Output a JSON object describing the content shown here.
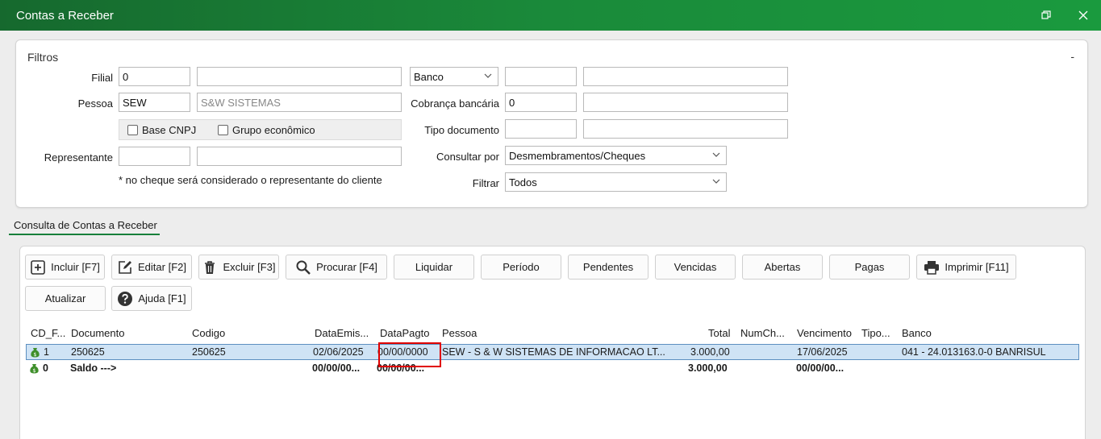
{
  "window": {
    "title": "Contas a Receber"
  },
  "filters": {
    "legend": "Filtros",
    "collapse": "-",
    "filial_label": "Filial",
    "filial_value": "0",
    "filial_desc": "",
    "pessoa_label": "Pessoa",
    "pessoa_value": "SEW",
    "pessoa_desc": "S&W SISTEMAS",
    "base_cnpj": "Base CNPJ",
    "grupo_economico": "Grupo econômico",
    "representante_label": "Representante",
    "representante_value": "",
    "representante_desc": "",
    "note": "* no cheque será considerado o representante do cliente",
    "banco_select": "Banco",
    "banco_code": "",
    "banco_desc": "",
    "cobranca_label": "Cobrança bancária",
    "cobranca_value": "0",
    "cobranca_desc": "",
    "tipo_doc_label": "Tipo documento",
    "tipo_doc_value": "",
    "tipo_doc_desc": "",
    "consultar_label": "Consultar por",
    "consultar_value": "Desmembramentos/Cheques",
    "filtrar_label": "Filtrar",
    "filtrar_value": "Todos"
  },
  "tab": {
    "label": "Consulta de Contas a Receber"
  },
  "toolbar": {
    "incluir": "Incluir [F7]",
    "editar": "Editar [F2]",
    "excluir": "Excluir [F3]",
    "procurar": "Procurar [F4]",
    "liquidar": "Liquidar",
    "periodo": "Período",
    "pendentes": "Pendentes",
    "vencidas": "Vencidas",
    "abertas": "Abertas",
    "pagas": "Pagas",
    "imprimir": "Imprimir [F11]",
    "atualizar": "Atualizar",
    "ajuda": "Ajuda [F1]"
  },
  "grid": {
    "columns": [
      "CD_F...",
      "Documento",
      "Codigo",
      "DataEmis...",
      "DataPagto",
      "Pessoa",
      "Total",
      "NumCh...",
      "Vencimento",
      "Tipo...",
      "Banco"
    ],
    "rows": [
      {
        "cd": "1",
        "documento": "250625",
        "codigo": "250625",
        "data_emissao": "02/06/2025",
        "data_pagto": "00/00/0000",
        "pessoa": "SEW - S & W SISTEMAS DE INFORMACAO LT...",
        "total": "3.000,00",
        "num_ch": "",
        "vencimento": "17/06/2025",
        "tipo": "",
        "banco": "041 - 24.013163.0-0 BANRISUL"
      },
      {
        "cd": "0",
        "documento": "Saldo --->",
        "codigo": "",
        "data_emissao": "00/00/00...",
        "data_pagto": "00/00/00...",
        "pessoa": "",
        "total": "3.000,00",
        "num_ch": "",
        "vencimento": "00/00/00...",
        "tipo": "",
        "banco": ""
      }
    ]
  },
  "colors": {
    "titlebar": "#1a8a3a",
    "accent": "#17803a",
    "selection": "#cfe3f5",
    "highlight_box": "#e00000"
  }
}
